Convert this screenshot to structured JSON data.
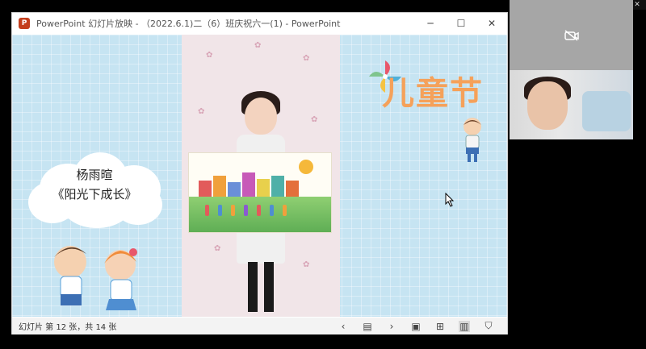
{
  "window": {
    "title": "PowerPoint 幻灯片放映 - （2022.6.1)二（6）班庆祝六一(1) - PowerPoint",
    "icon": "powerpoint-icon",
    "controls": [
      "minimize-icon",
      "maximize-icon",
      "close-icon"
    ]
  },
  "slide": {
    "student_name": "杨雨暄",
    "artwork_title": "《阳光下成长》",
    "festival_text": "儿童节"
  },
  "statusbar": {
    "slide_info": "幻灯片 第 12 张，共 14 张",
    "icons": [
      "prev-slide-icon",
      "slide-menu-icon",
      "next-slide-icon",
      "normal-view-icon",
      "slide-sorter-icon",
      "reading-view-icon",
      "slideshow-icon"
    ]
  },
  "video": {
    "camera_off_icon": "camera-off-icon",
    "tile_buttons": [
      "minimize-icon",
      "restore-icon",
      "close-icon"
    ]
  },
  "colors": {
    "slide_bg": "#c6e4f2",
    "ppt_brand": "#c43e1c",
    "festival_orange": "#f5a15a",
    "festival_green": "#7fc48d"
  }
}
